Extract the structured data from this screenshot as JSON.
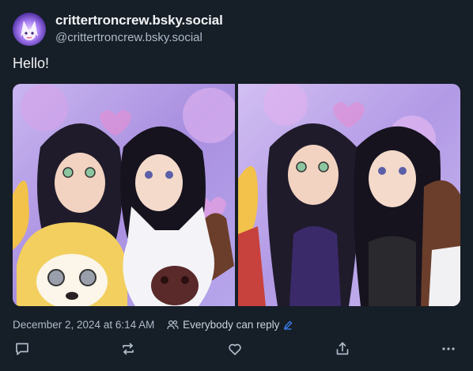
{
  "post": {
    "display_name": "crittertroncrew.bsky.social",
    "handle": "@crittertroncrew.bsky.social",
    "text": "Hello!",
    "timestamp": "December 2, 2024 at 6:14 AM",
    "reply_setting": "Everybody can reply",
    "images": [
      {
        "name": "image-1"
      },
      {
        "name": "image-2"
      }
    ]
  },
  "actions": {
    "reply_icon": "speech-bubble-icon",
    "repost_icon": "repost-arrows-icon",
    "like_icon": "heart-icon",
    "share_icon": "share-upload-icon",
    "more_icon": "more-dots-icon"
  },
  "colors": {
    "background": "#161e27",
    "primary_text": "#f1f3f5",
    "secondary_text": "#aebbc9",
    "icon": "#aebbc9",
    "accent": "#3b82f6"
  }
}
